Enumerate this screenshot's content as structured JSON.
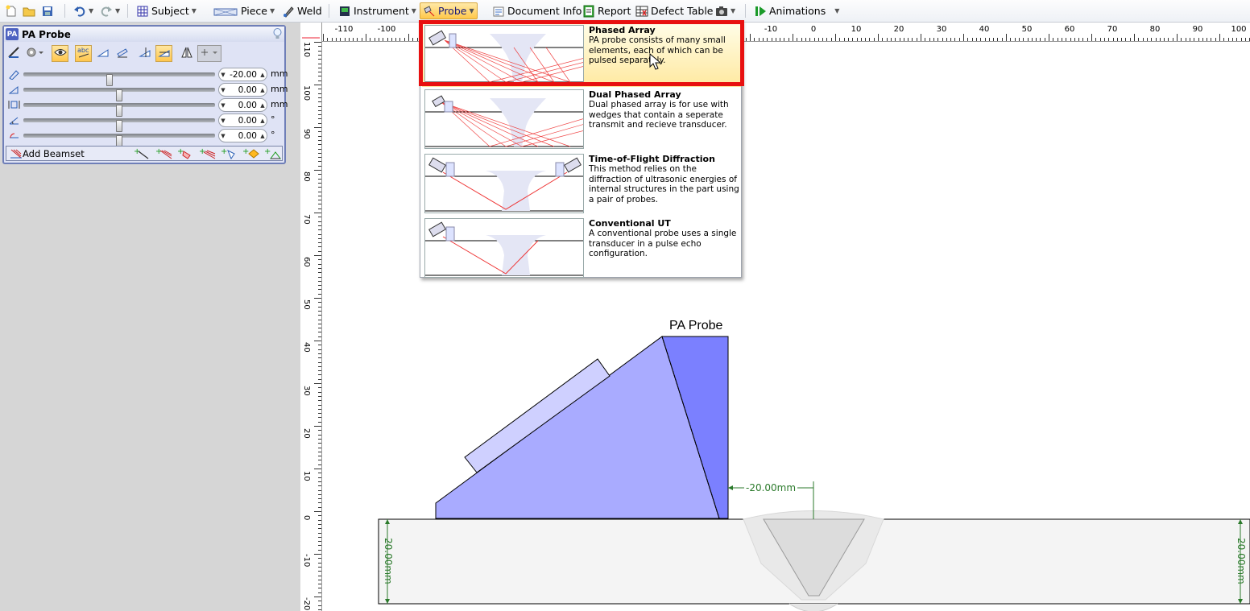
{
  "toolbar": {
    "subject": "Subject",
    "piece": "Piece",
    "weld": "Weld",
    "instrument": "Instrument",
    "probe": "Probe",
    "document_info": "Document Info",
    "report": "Report",
    "defect_table": "Defect Table",
    "animations": "Animations"
  },
  "panel": {
    "badge": "PA",
    "title": "PA Probe",
    "sliders": [
      {
        "value": "-20.00",
        "unit": "mm",
        "position": 0.45
      },
      {
        "value": "0.00",
        "unit": "mm",
        "position": 0.5
      },
      {
        "value": "0.00",
        "unit": "mm",
        "position": 0.5
      },
      {
        "value": "0.00",
        "unit": "°",
        "position": 0.5
      },
      {
        "value": "0.00",
        "unit": "°",
        "position": 0.5
      }
    ],
    "add_beamset": "Add Beamset"
  },
  "ruler": {
    "h_labels": [
      "-110",
      "-100",
      "-10",
      "0",
      "10",
      "20",
      "30",
      "40",
      "50",
      "60",
      "70",
      "80",
      "90",
      "100"
    ],
    "v_labels": [
      "110",
      "100",
      "90",
      "80",
      "70",
      "60",
      "50",
      "40",
      "30",
      "20",
      "10",
      "0",
      "-10",
      "-20"
    ]
  },
  "probe_menu": {
    "items": [
      {
        "title": "Phased Array",
        "desc": "PA probe consists of many small elements, each of which can be pulsed separately."
      },
      {
        "title": "Dual Phased Array",
        "desc": "Dual phased array is for use with wedges that contain a seperate transmit and recieve transducer."
      },
      {
        "title": "Time-of-Flight Diffraction",
        "desc": "This method relies on the diffraction of ultrasonic energies of internal structures  in the part using a pair of probes."
      },
      {
        "title": "Conventional UT",
        "desc": "A conventional probe uses a single transducer in a pulse echo configuration."
      }
    ]
  },
  "drawing": {
    "probe_label": "PA Probe",
    "offset_dim": "-20.00mm",
    "thickness_dim_left": "20.00mm",
    "thickness_dim_right": "20.00mm"
  },
  "colors": {
    "highlight": "#e81010",
    "accent": "#ffc84a",
    "wedge": "#a9abff",
    "probe_face": "#7b80ff",
    "dimension": "#2b7a2b"
  }
}
